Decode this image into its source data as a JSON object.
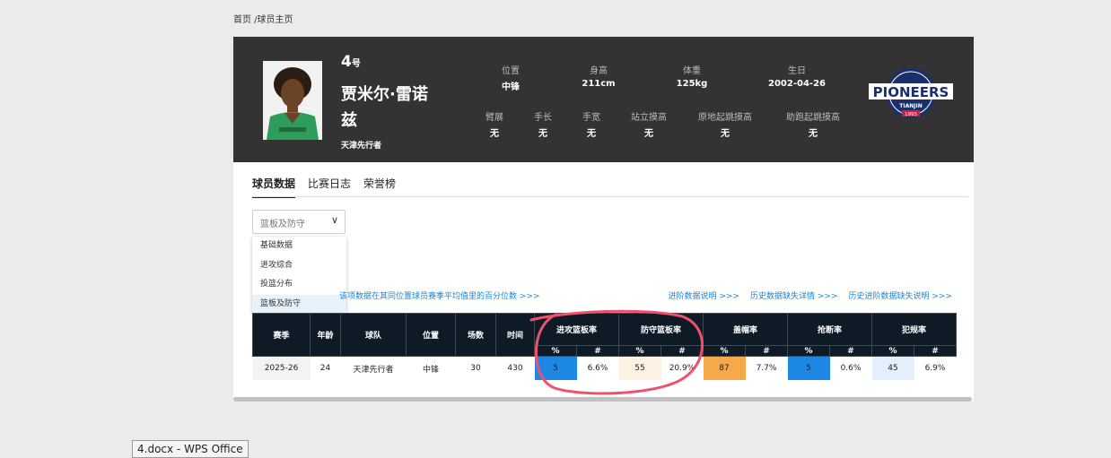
{
  "breadcrumb": "首页 /球员主页",
  "player": {
    "number": "4",
    "number_suffix": "号",
    "name": "贾米尔·雷诺兹",
    "team": "天津先行者"
  },
  "attributes_row1": [
    {
      "label": "位置",
      "value": "中锋"
    },
    {
      "label": "身高",
      "value": "211cm"
    },
    {
      "label": "体重",
      "value": "125kg"
    },
    {
      "label": "生日",
      "value": "2002-04-26"
    }
  ],
  "attributes_row2": [
    {
      "label": "臂展",
      "value": "无"
    },
    {
      "label": "手长",
      "value": "无"
    },
    {
      "label": "手宽",
      "value": "无"
    },
    {
      "label": "站立摸高",
      "value": "无"
    },
    {
      "label": "原地起跳摸高",
      "value": "无"
    },
    {
      "label": "助跑起跳摸高",
      "value": "无"
    }
  ],
  "logo": {
    "text": "PIONEERS",
    "sub": "TIANJIN",
    "year": "1995"
  },
  "tabs": [
    "球员数据",
    "比赛日志",
    "荣誉榜"
  ],
  "select": {
    "value": "篮板及防守",
    "options": [
      "基础数据",
      "进攻综合",
      "投篮分布",
      "篮板及防守"
    ]
  },
  "note": "该项数据在其同位置球员赛季平均值里的百分位数 >>>",
  "links": [
    "进阶数据说明 >>>",
    "历史数据缺失详情 >>>",
    "历史进阶数据缺失说明 >>>"
  ],
  "table": {
    "headers": [
      "赛季",
      "年龄",
      "球队",
      "位置",
      "场数",
      "时间"
    ],
    "groups": [
      "进攻篮板率",
      "防守篮板率",
      "盖帽率",
      "抢断率",
      "犯规率"
    ],
    "sub": [
      "%",
      "#"
    ],
    "row": {
      "season": "2025-26",
      "age": "24",
      "team": "天津先行者",
      "position": "中锋",
      "games": "30",
      "minutes": "430",
      "oreb_pct": "5",
      "oreb": "6.6%",
      "dreb_pct": "55",
      "dreb": "20.9%",
      "blk_pct": "87",
      "blk": "7.7%",
      "stl_pct": "5",
      "stl": "0.6%",
      "foul_pct": "45",
      "foul": "6.9%"
    }
  },
  "colors": {
    "blue": "#1e88e5",
    "orange": "#f5a94a",
    "light_peach": "#fdf1e4",
    "light_blue": "#e3f0fc",
    "header": "#333333",
    "annotation": "#f0506e"
  },
  "taskbar": "4.docx - WPS Office"
}
